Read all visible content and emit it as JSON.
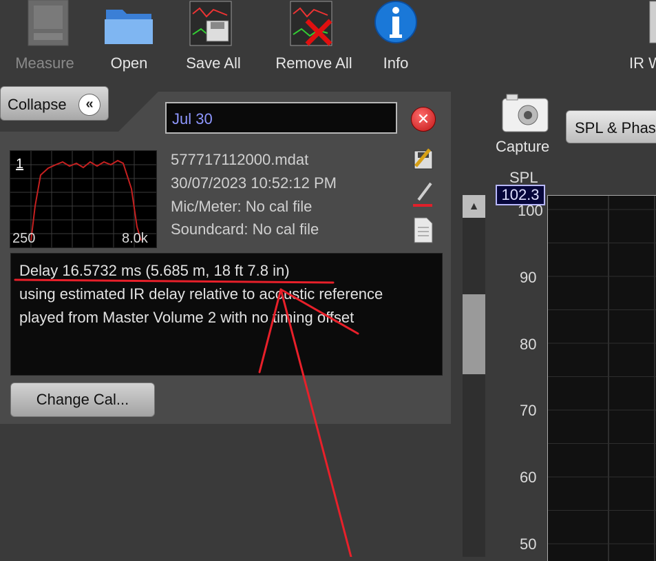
{
  "toolbar": {
    "measure": "Measure",
    "open": "Open",
    "save_all": "Save All",
    "remove_all": "Remove All",
    "info": "Info",
    "ir_windows_partial": "IR W"
  },
  "collapse": {
    "label": "Collapse"
  },
  "measurement": {
    "name": "Jul 30",
    "filename": "577717112000.mdat",
    "datetime": "30/07/2023 10:52:12 PM",
    "mic_meter": "Mic/Meter: No cal file",
    "soundcard": "Soundcard: No cal file",
    "thumb_index": "1",
    "thumb_low": "250",
    "thumb_high": "8.0k"
  },
  "notes": {
    "line1": "Delay 16.5732 ms (5.685 m, 18 ft 7.8 in)",
    "line2": "using estimated IR delay relative to acoustic reference",
    "line3": "played from Master Volume 2 with no timing offset"
  },
  "buttons": {
    "change_cal": "Change Cal..."
  },
  "graph": {
    "capture": "Capture",
    "selector": "SPL & Phase",
    "axis_title": "SPL",
    "readout": "102.3",
    "yticks": [
      "100",
      "90",
      "80",
      "70",
      "60",
      "50"
    ]
  },
  "colors": {
    "annotation": "#e8202a",
    "trace": "#cc2222"
  }
}
